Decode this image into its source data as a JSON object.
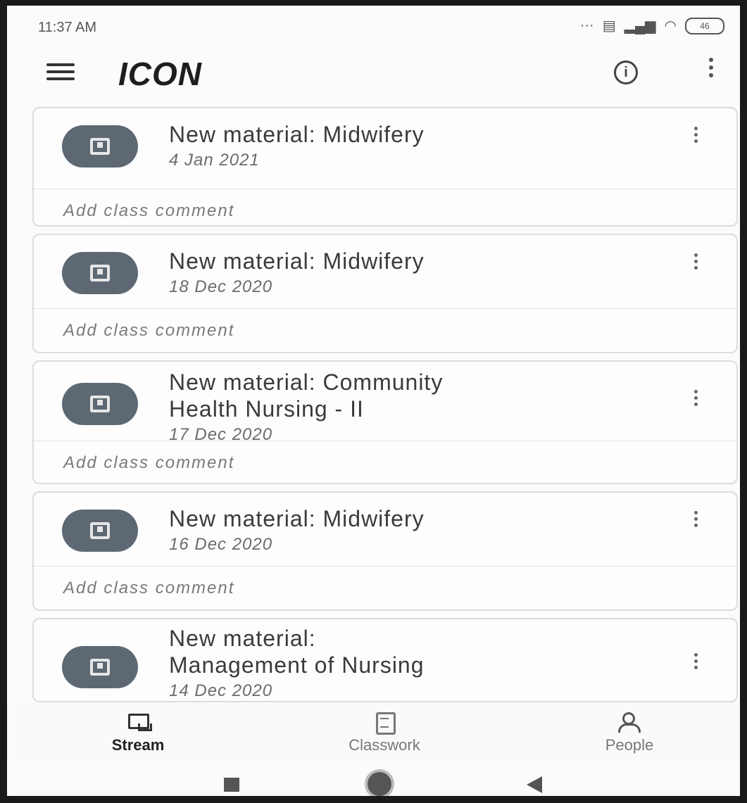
{
  "status_bar": {
    "time": "11:37 AM",
    "icons": [
      "notification-dots-icon",
      "sim-icon",
      "signal-icon",
      "wifi-icon",
      "battery-icon"
    ],
    "battery": "46"
  },
  "app_bar": {
    "title": "ICON",
    "menu_icon": "hamburger-menu-icon",
    "info_icon": "info-icon",
    "more_icon": "more-vert-icon"
  },
  "posts": [
    {
      "title_lines": [
        "New material: Midwifery"
      ],
      "date": "4 Jan 2021",
      "comment": "Add class comment"
    },
    {
      "title_lines": [
        "New material: Midwifery"
      ],
      "date": "18 Dec 2020",
      "comment": "Add class comment"
    },
    {
      "title_lines": [
        "New material: Community",
        "Health Nursing - II"
      ],
      "date": "17 Dec 2020",
      "comment": "Add class comment"
    },
    {
      "title_lines": [
        "New material: Midwifery"
      ],
      "date": "16 Dec 2020",
      "comment": "Add class comment"
    },
    {
      "title_lines": [
        "New material:",
        "Management of Nursing"
      ],
      "date": "14 Dec 2020",
      "comment": ""
    }
  ],
  "bottom_nav": {
    "items": [
      {
        "label": "Stream",
        "icon": "stream-icon",
        "active": true
      },
      {
        "label": "Classwork",
        "icon": "classwork-icon",
        "active": false
      },
      {
        "label": "People",
        "icon": "people-icon",
        "active": false
      }
    ]
  },
  "system_nav": {
    "icons": [
      "recents-icon",
      "home-icon",
      "back-icon"
    ]
  },
  "colors": {
    "avatar": "#5d6873",
    "title_text": "#3b3b3b",
    "background": "#fbfbfb"
  }
}
